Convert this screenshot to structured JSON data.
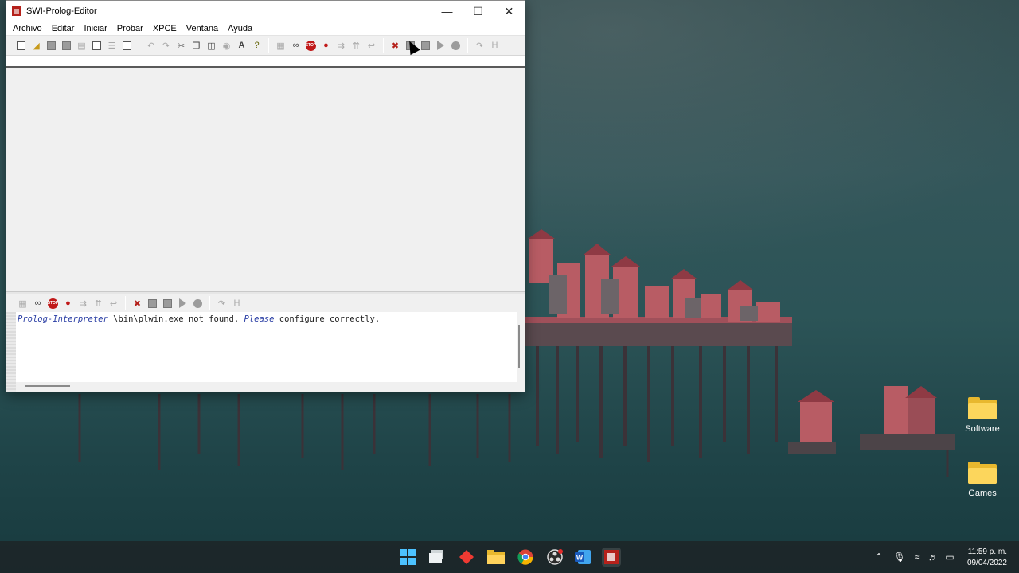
{
  "window": {
    "title": "SWI-Prolog-Editor",
    "controls": {
      "minimize": "—",
      "maximize": "☐",
      "close": "✕"
    }
  },
  "menu": [
    "Archivo",
    "Editar",
    "Iniciar",
    "Probar",
    "XPCE",
    "Ventana",
    "Ayuda"
  ],
  "console": {
    "keyword1": "Prolog-Interpreter",
    "text1": " \\bin\\plwin.exe not found. ",
    "keyword2": "Please",
    "text2": " configure correctly."
  },
  "desktop_icons": [
    "Software",
    "Games"
  ],
  "taskbar": {
    "apps": [
      "windows-start",
      "task-view",
      "anydesk",
      "file-explorer",
      "chrome",
      "obs",
      "word",
      "swi-prolog-editor"
    ]
  },
  "clock": {
    "time": "11:59 p. m.",
    "date": "09/04/2022"
  }
}
